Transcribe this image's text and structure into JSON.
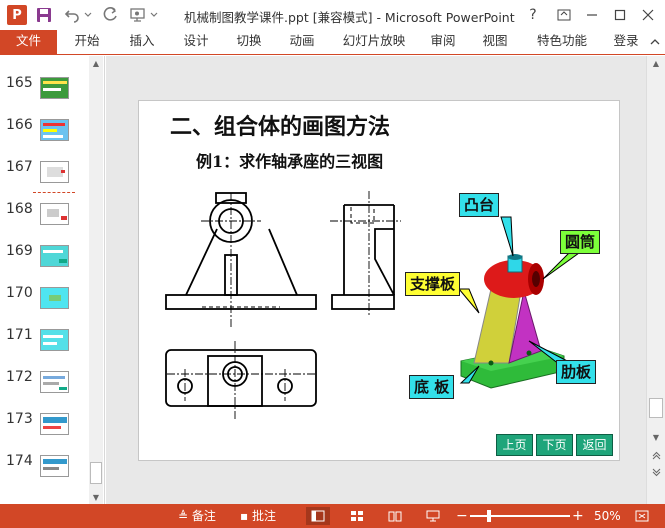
{
  "window": {
    "title": "机械制图教学课件.ppt [兼容模式] - Microsoft PowerPoint",
    "help": "?",
    "app_icon": "P"
  },
  "ribbon": {
    "tabs": [
      "文件",
      "开始",
      "插入",
      "设计",
      "切换",
      "动画",
      "幻灯片放映",
      "审阅",
      "视图",
      "特色功能"
    ],
    "login": "登录"
  },
  "thumbnails": [
    {
      "num": "165"
    },
    {
      "num": "166"
    },
    {
      "num": "167"
    },
    {
      "num": "168"
    },
    {
      "num": "169"
    },
    {
      "num": "170"
    },
    {
      "num": "171"
    },
    {
      "num": "172"
    },
    {
      "num": "173"
    },
    {
      "num": "174"
    }
  ],
  "slide": {
    "title": "二、组合体的画图方法",
    "subtitle": "例1：求作轴承座的三视图",
    "callouts": {
      "boss": "凸台",
      "cylinder": "圆筒",
      "support": "支撑板",
      "rib": "肋板",
      "base": "底 板"
    },
    "nav": {
      "prev": "上页",
      "next": "下页",
      "back": "返回"
    }
  },
  "statusbar": {
    "notes": "备注",
    "comments": "批注",
    "zoom": "50%"
  },
  "colors": {
    "accent": "#d24726",
    "callout_cyan": "#33e0ea",
    "callout_green": "#7cff3a",
    "callout_yellow": "#ffff33",
    "nav_green": "#1fa57a"
  }
}
